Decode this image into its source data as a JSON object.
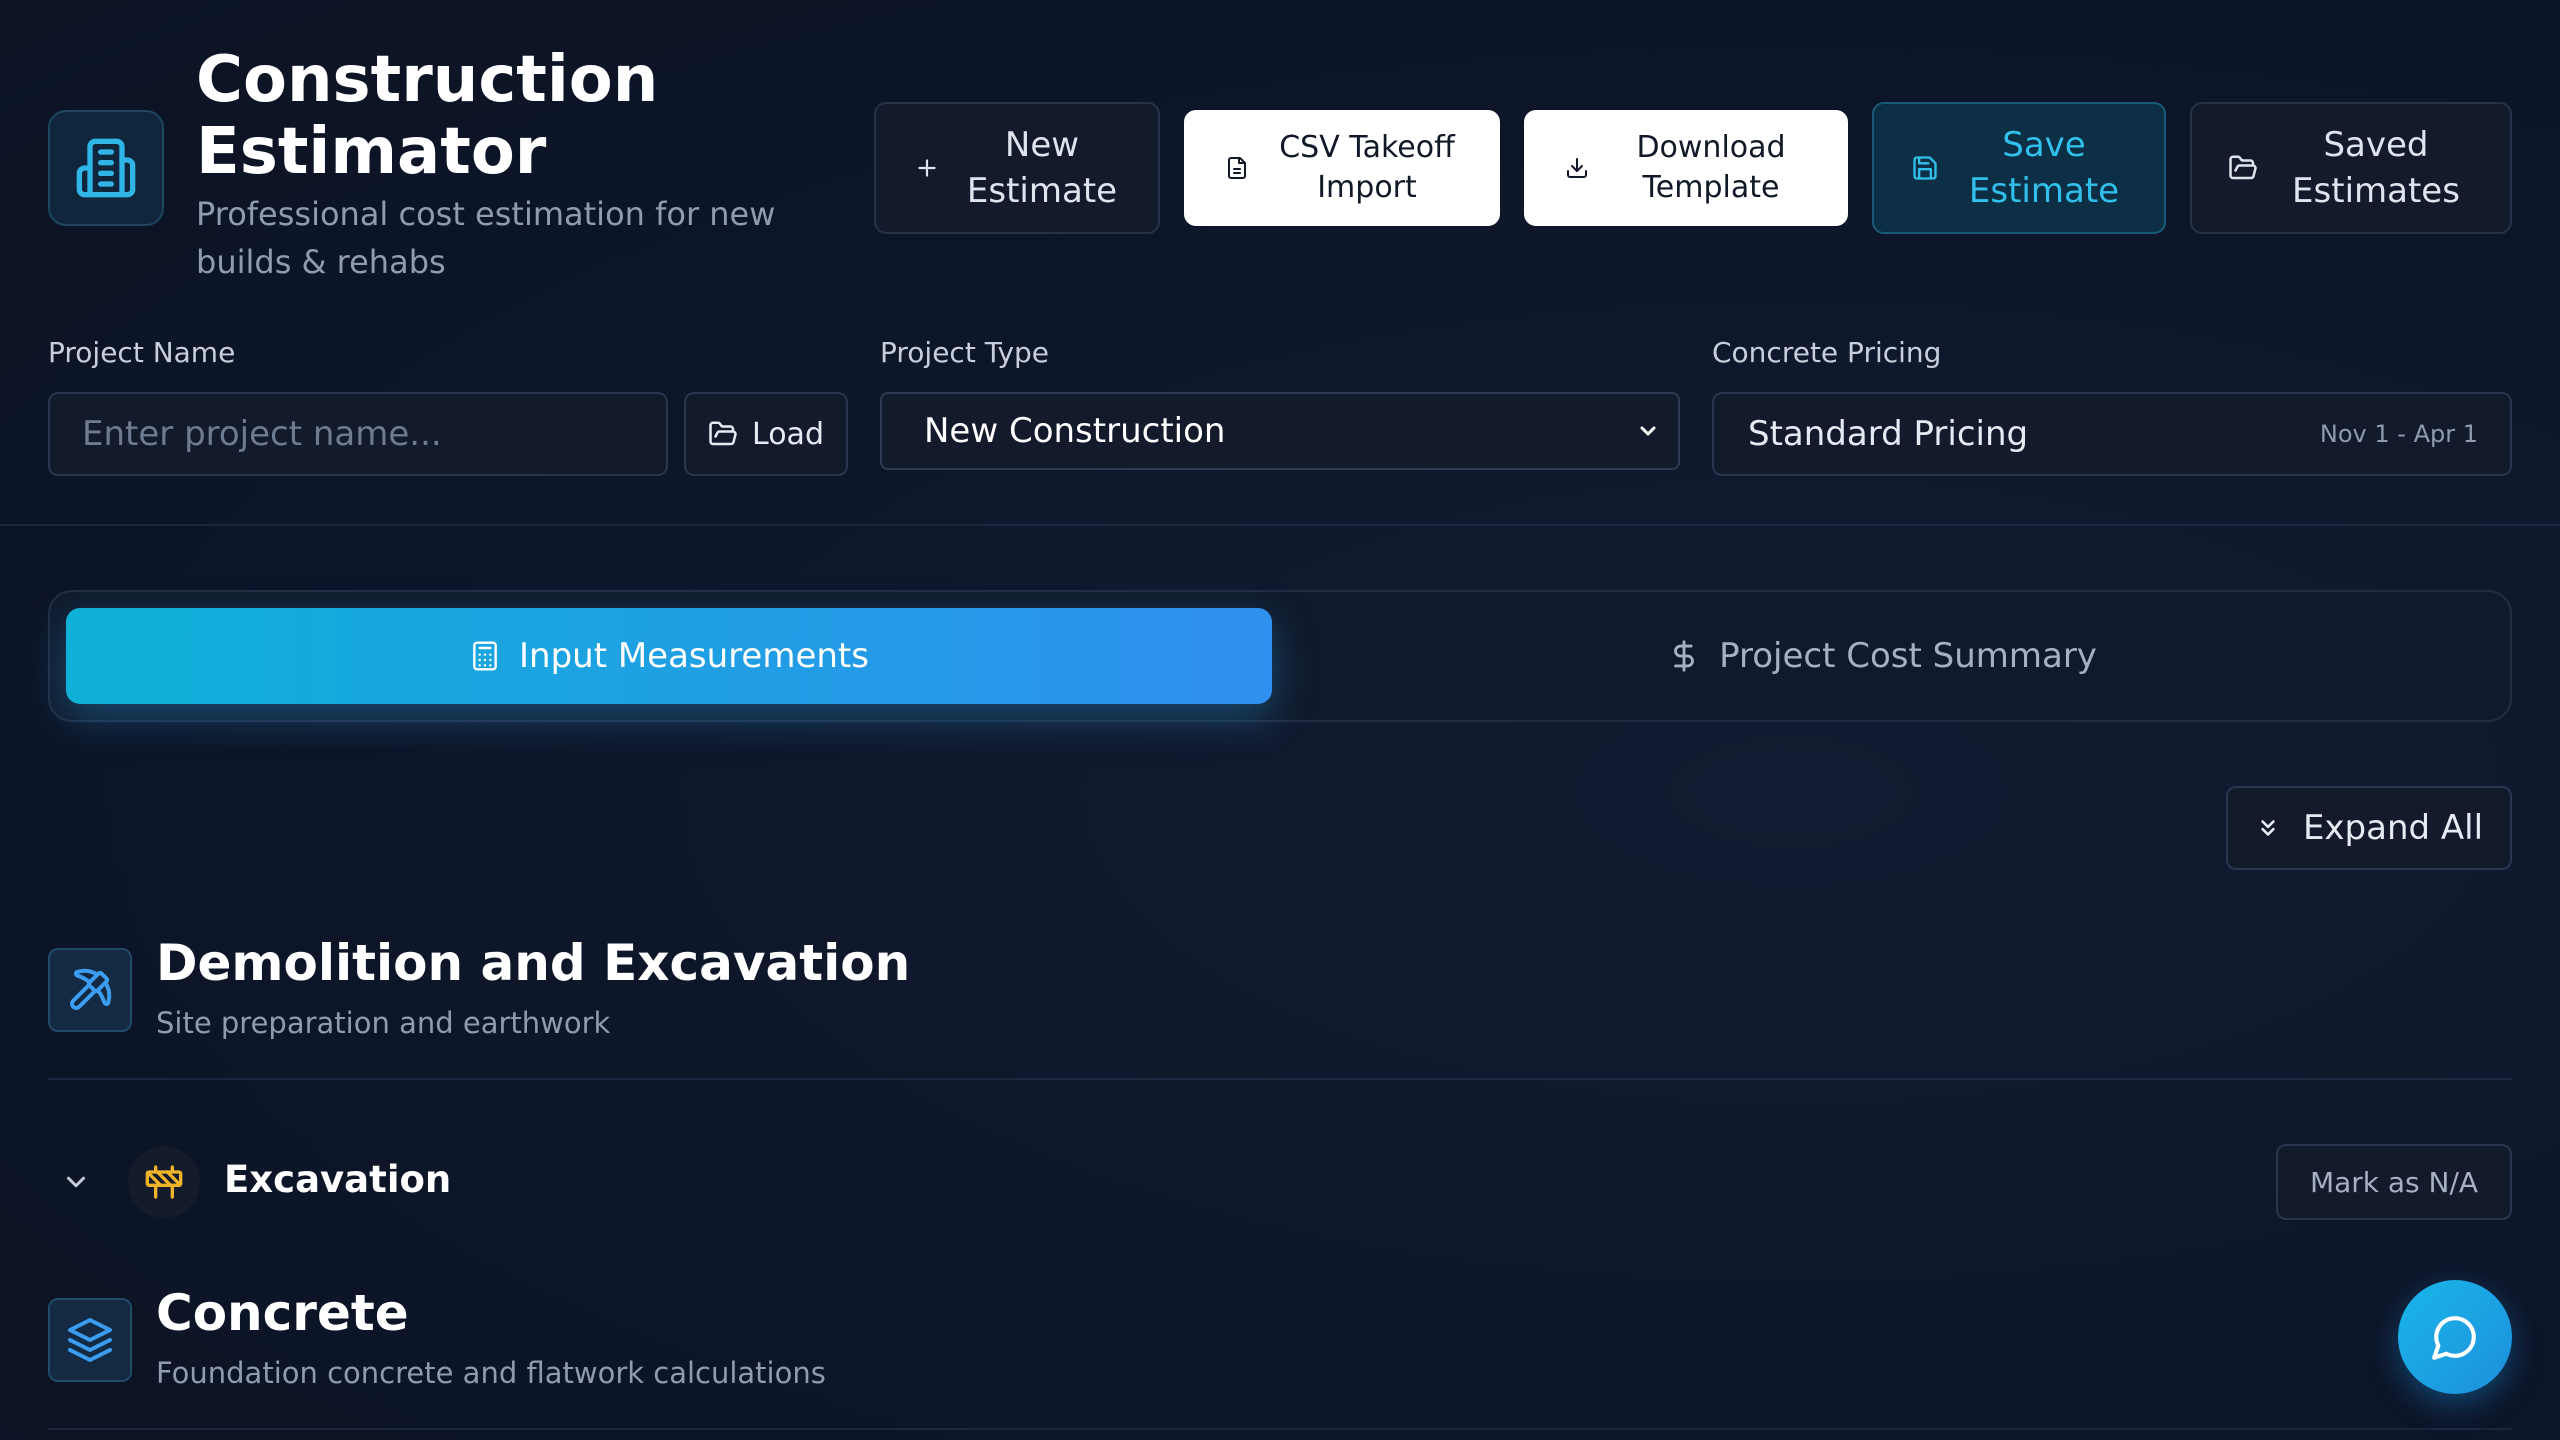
{
  "header": {
    "title": "Construction Estimator",
    "subtitle": "Professional cost estimation for new builds & rehabs",
    "buttons": {
      "new_estimate": "New Estimate",
      "csv_import": "CSV Takeoff Import",
      "download_template": "Download Template",
      "save_estimate": "Save Estimate",
      "saved_estimates": "Saved Estimates"
    }
  },
  "form": {
    "project_name_label": "Project Name",
    "project_name_placeholder": "Enter project name...",
    "load_label": "Load",
    "project_type_label": "Project Type",
    "project_type_value": "New Construction",
    "concrete_pricing_label": "Concrete Pricing",
    "concrete_pricing_value": "Standard Pricing",
    "concrete_pricing_dates": "Nov 1 - Apr 1"
  },
  "tabs": {
    "input": "Input Measurements",
    "summary": "Project Cost Summary"
  },
  "expand_all": "Expand All",
  "sections": {
    "demolition": {
      "title": "Demolition and Excavation",
      "subtitle": "Site preparation and earthwork",
      "items": [
        {
          "title": "Excavation",
          "action": "Mark as N/A"
        }
      ]
    },
    "concrete": {
      "title": "Concrete",
      "subtitle": "Foundation concrete and flatwork calculations"
    }
  },
  "colors": {
    "background": "#0d1528",
    "accent_cyan": "#31c0ec",
    "accent_gradient_start": "#0fb1d8",
    "accent_gradient_end": "#2f8fee",
    "excavation_icon": "#f0b429"
  },
  "icons": {
    "logo": "building-icon",
    "demolition": "pickaxe-icon",
    "excavation": "construction-barrier-icon",
    "concrete": "layers-icon",
    "chat": "chat-bubble-icon"
  }
}
